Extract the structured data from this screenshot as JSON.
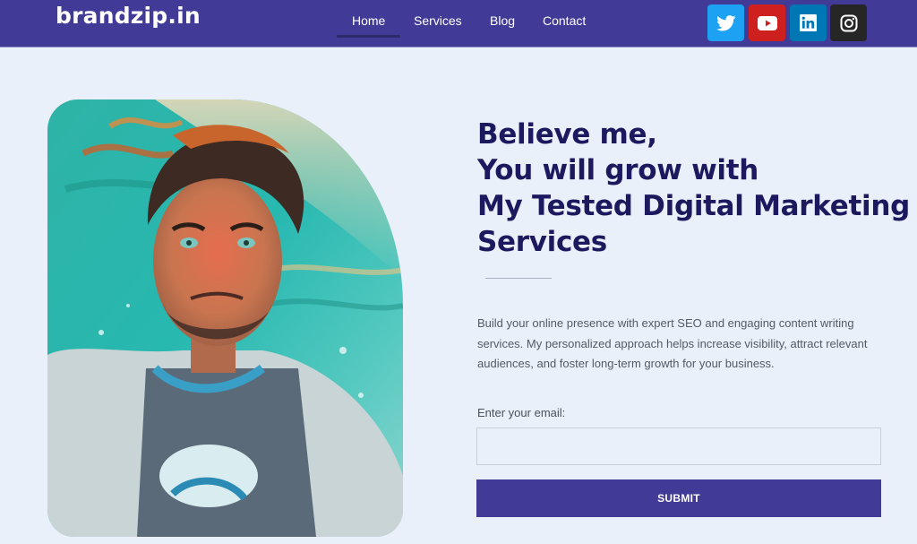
{
  "header": {
    "brand": "brandzip.in",
    "nav": [
      {
        "label": "Home",
        "active": true
      },
      {
        "label": "Services",
        "active": false
      },
      {
        "label": "Blog",
        "active": false
      },
      {
        "label": "Contact",
        "active": false
      }
    ],
    "social": [
      {
        "name": "twitter",
        "icon": "twitter-icon",
        "color": "#1da1f2"
      },
      {
        "name": "youtube",
        "icon": "youtube-icon",
        "color": "#cd201f"
      },
      {
        "name": "linkedin",
        "icon": "linkedin-icon",
        "color": "#0077b5"
      },
      {
        "name": "instagram",
        "icon": "instagram-icon",
        "color": "#262626"
      }
    ]
  },
  "hero": {
    "image_alt": "Illustrated portrait of a young man underwater",
    "headline_lines": [
      "Believe me,",
      "You will grow with",
      "My Tested Digital Marketing",
      "Services"
    ],
    "description": "Build your online presence with expert SEO and engaging content writing services. My personalized approach helps increase visibility, attract relevant audiences, and foster long-term growth for your business.",
    "form": {
      "email_label": "Enter your email:",
      "email_value": "",
      "email_placeholder": "",
      "submit_label": "SUBMIT"
    }
  },
  "colors": {
    "brand": "#413a96",
    "background": "#e9f0f9",
    "headline": "#1b1a5e"
  }
}
